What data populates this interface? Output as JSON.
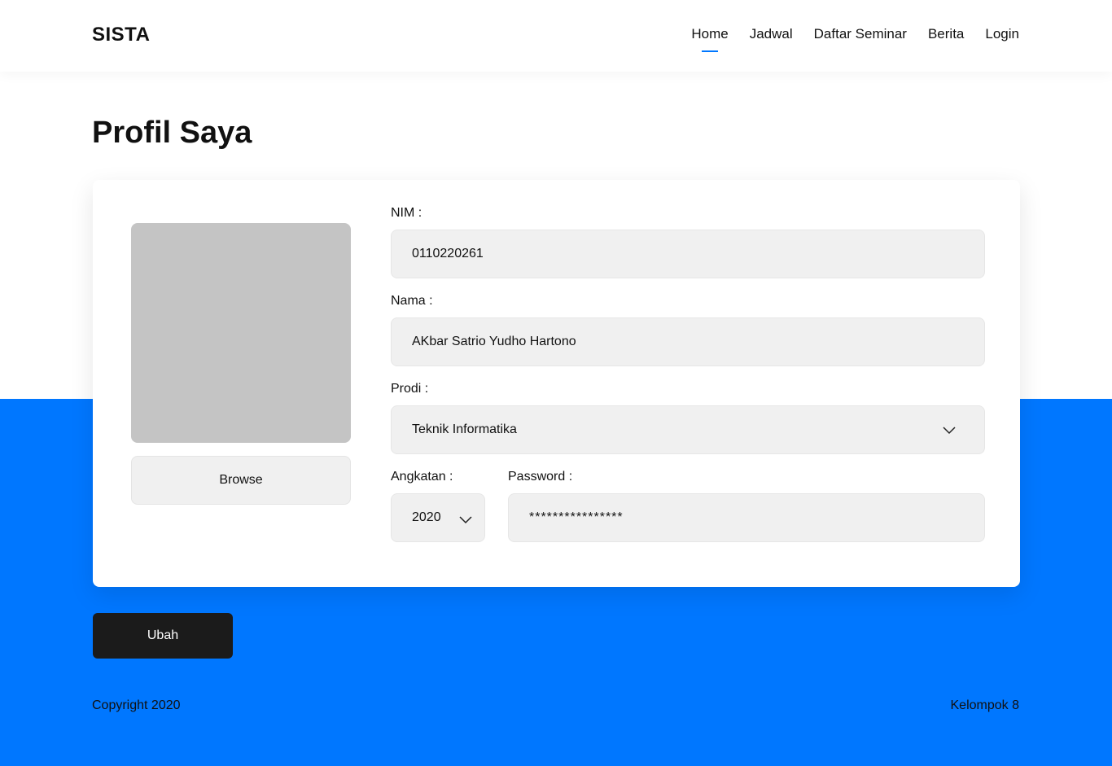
{
  "brand": "SISTA",
  "nav": {
    "items": [
      {
        "label": "Home",
        "active": true
      },
      {
        "label": "Jadwal",
        "active": false
      },
      {
        "label": "Daftar Seminar",
        "active": false
      },
      {
        "label": "Berita",
        "active": false
      },
      {
        "label": "Login",
        "active": false
      }
    ]
  },
  "page_title": "Profil Saya",
  "profile": {
    "browse_label": "Browse",
    "nim_label": "NIM :",
    "nim_value": "0110220261",
    "nama_label": "Nama :",
    "nama_value": "AKbar Satrio Yudho Hartono",
    "prodi_label": "Prodi :",
    "prodi_value": "Teknik Informatika",
    "angkatan_label": "Angkatan :",
    "angkatan_value": "2020",
    "password_label": "Password :",
    "password_value": "****************"
  },
  "submit_label": "Ubah",
  "footer": {
    "copyright": "Copyright 2020",
    "group": "Kelompok 8"
  },
  "colors": {
    "accent": "#0077ff",
    "button_dark": "#1b1b1b",
    "field_bg": "#f0f0f0",
    "photo_placeholder": "#c4c4c4"
  },
  "icons": {
    "prodi_dropdown": "chevron-down-icon",
    "angkatan_dropdown": "chevron-down-icon"
  }
}
